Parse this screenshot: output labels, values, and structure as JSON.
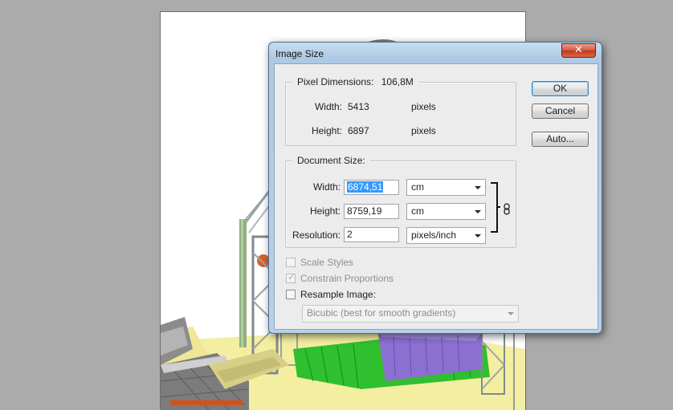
{
  "dialog": {
    "title": "Image Size",
    "close_symbol": "✕",
    "pixel_dimensions": {
      "label": "Pixel Dimensions:",
      "value": "106,8M",
      "width_label": "Width:",
      "width_value": "5413",
      "width_unit": "pixels",
      "height_label": "Height:",
      "height_value": "6897",
      "height_unit": "pixels"
    },
    "document_size": {
      "label": "Document Size:",
      "width_label": "Width:",
      "width_value": "6874,51",
      "width_unit": "cm",
      "height_label": "Height:",
      "height_value": "8759,19",
      "height_unit": "cm",
      "resolution_label": "Resolution:",
      "resolution_value": "2",
      "resolution_unit": "pixels/inch"
    },
    "options": {
      "scale_styles": {
        "label": "Scale Styles",
        "checked": false,
        "enabled": false
      },
      "constrain_proportions": {
        "label": "Constrain Proportions",
        "checked": true,
        "enabled": false
      },
      "resample_image": {
        "label": "Resample Image:",
        "checked": false,
        "enabled": true
      },
      "resample_method": "Bicubic (best for smooth gradients)"
    },
    "buttons": {
      "ok": "OK",
      "cancel": "Cancel",
      "auto": "Auto..."
    }
  },
  "colors": {
    "selection": "#3399ff",
    "close_button": "#c8402a",
    "title_bar": "#b8d0e8",
    "workspace": "#ababab"
  },
  "icons": [
    "close-icon",
    "link-chain-icon",
    "checkmark-icon",
    "chevron-down-icon"
  ]
}
